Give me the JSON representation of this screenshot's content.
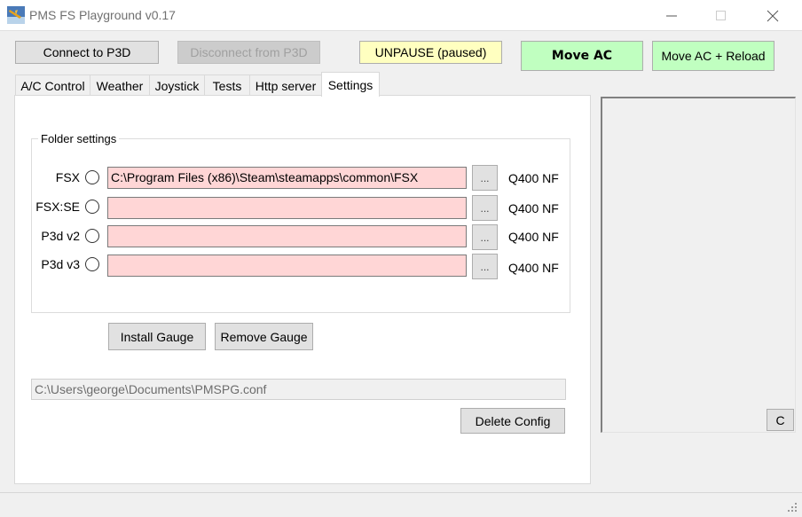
{
  "window": {
    "title": "PMS FS Playground v0.17",
    "icons": {
      "app": "airplane-app-icon",
      "minimize": "minimize-icon",
      "maximize": "maximize-icon",
      "close": "close-icon"
    }
  },
  "toolbar": {
    "connect": "Connect to P3D",
    "disconnect": "Disconnect from P3D",
    "unpause": "UNPAUSE (paused)",
    "move_ac": "Move AC",
    "move_ac_reload": "Move AC + Reload"
  },
  "tabs": [
    {
      "label": "A/C Control"
    },
    {
      "label": "Weather"
    },
    {
      "label": "Joystick"
    },
    {
      "label": "Tests"
    },
    {
      "label": "Http server"
    },
    {
      "label": "Settings",
      "active": true
    }
  ],
  "settings": {
    "group_title": "Folder settings",
    "rows": [
      {
        "label": "FSX",
        "path": "C:\\Program Files (x86)\\Steam\\steamapps\\common\\FSX",
        "browse": "...",
        "status": "Q400 NF"
      },
      {
        "label": "FSX:SE",
        "path": "",
        "browse": "...",
        "status": "Q400 NF"
      },
      {
        "label": "P3d v2",
        "path": "",
        "browse": "...",
        "status": "Q400 NF"
      },
      {
        "label": "P3d v3",
        "path": "",
        "browse": "...",
        "status": "Q400 NF"
      }
    ],
    "install_gauge": "Install Gauge",
    "remove_gauge": "Remove Gauge",
    "config_path": "C:\\Users\\george\\Documents\\PMSPG.conf",
    "delete_config": "Delete Config"
  },
  "right_panel": {
    "clear_button": "C"
  },
  "colors": {
    "path_invalid_bg": "#ffd6d6",
    "unpause_bg": "#ffffc0",
    "move_bg": "#c0ffc0"
  }
}
